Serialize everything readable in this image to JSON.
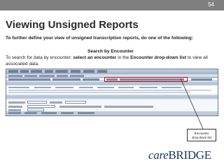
{
  "slide": {
    "number": "54",
    "title": "Viewing Unsigned Reports",
    "intro": "To further define your view of unsigned transcription reports, do one of the following:",
    "subheading": "Search by Encounter",
    "instruction_prefix": "To search for data by encounter:  ",
    "instruction_bold": "select an encounter",
    "instruction_middle": " in the ",
    "instruction_bold2": "Encounter drop-down list",
    "instruction_suffix": " to view all associated data."
  },
  "callout": {
    "line1": "Encounter",
    "line2": "drop-down list"
  },
  "logo": {
    "part1": "care",
    "part2": "BRIDGE"
  },
  "colors": {
    "top_band": "#7f7f7f",
    "highlight": "#d40000",
    "logo": "#17375e"
  }
}
